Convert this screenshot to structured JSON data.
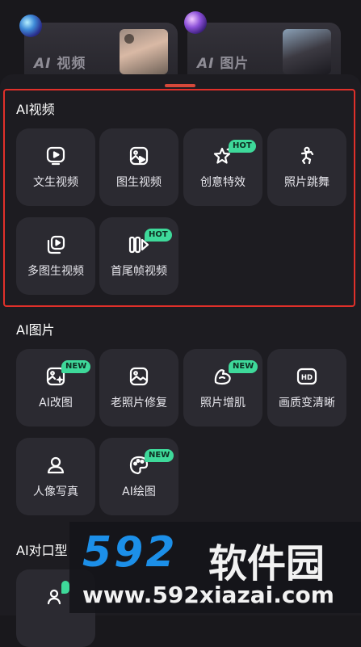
{
  "top_cards": {
    "video": {
      "ai": "AI",
      "label": "视频"
    },
    "image": {
      "ai": "AI",
      "label": "图片"
    }
  },
  "sections": {
    "ai_video": {
      "title": "AI视频",
      "items": [
        {
          "label": "文生视频",
          "icon": "play-screen-icon",
          "badge": ""
        },
        {
          "label": "图生视频",
          "icon": "image-play-icon",
          "badge": ""
        },
        {
          "label": "创意特效",
          "icon": "sparkle-star-icon",
          "badge": "HOT"
        },
        {
          "label": "照片跳舞",
          "icon": "dancing-figure-icon",
          "badge": ""
        },
        {
          "label": "多图生视频",
          "icon": "stacked-images-play-icon",
          "badge": ""
        },
        {
          "label": "首尾帧视频",
          "icon": "frames-play-icon",
          "badge": "HOT"
        }
      ]
    },
    "ai_image": {
      "title": "AI图片",
      "items": [
        {
          "label": "AI改图",
          "icon": "image-edit-icon",
          "badge": "NEW"
        },
        {
          "label": "老照片修复",
          "icon": "photo-icon",
          "badge": ""
        },
        {
          "label": "照片增肌",
          "icon": "muscle-arm-icon",
          "badge": "NEW"
        },
        {
          "label": "画质变清晰",
          "icon": "hd-icon",
          "badge": ""
        },
        {
          "label": "人像写真",
          "icon": "portrait-icon",
          "badge": ""
        },
        {
          "label": "AI绘图",
          "icon": "palette-icon",
          "badge": "NEW"
        }
      ]
    },
    "ai_lipsync": {
      "title": "AI对口型"
    }
  },
  "watermark": {
    "logo_num": "592",
    "logo_cn": "软件园",
    "url": "www.592xiazai.com"
  },
  "colors": {
    "background": "#19181c",
    "tile": "#2b2a31",
    "badge": "#3ed99a",
    "highlight": "#e0302a",
    "watermark_blue": "#1c8fe8"
  }
}
